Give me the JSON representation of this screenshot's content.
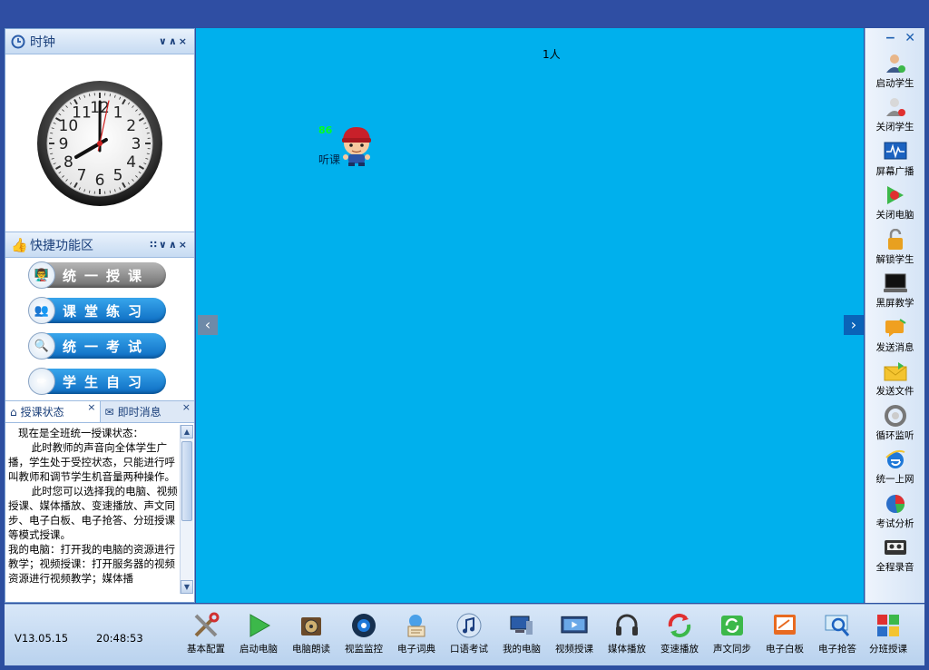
{
  "clock_panel": {
    "title": "时钟",
    "time": {
      "hour": 8,
      "minute": 0,
      "second": 2
    },
    "numerals": [
      "12",
      "1",
      "2",
      "3",
      "4",
      "5",
      "6",
      "7",
      "8",
      "9",
      "10",
      "11"
    ]
  },
  "quick_panel": {
    "title": "快捷功能区",
    "buttons": [
      {
        "label": "统一授课",
        "style": "gray",
        "icon": "teaching-icon"
      },
      {
        "label": "课堂练习",
        "style": "blue",
        "icon": "group-icon"
      },
      {
        "label": "统一考试",
        "style": "blue",
        "icon": "exam-icon"
      },
      {
        "label": "学生自习",
        "style": "blue",
        "icon": "pencil-icon"
      }
    ]
  },
  "tabs": [
    {
      "label": "授课状态",
      "icon": "home-icon",
      "close": "×"
    },
    {
      "label": "即时消息",
      "icon": "envelope-icon",
      "close": "×"
    }
  ],
  "status_text": [
    "   现在是全班统一授课状态：",
    "       此时教师的声音向全体学生广播，学生处于受控状态，只能进行呼叫教师和调节学生机音量两种操作。",
    "       此时您可以选择我的电脑、视频授课、媒体播放、变速播放、声文同步、电子白板、电子抢答、分班授课等模式授课。",
    "我的电脑：打开我的电脑的资源进行教学；视频授课：打开服务器的视频资源进行视频教学；媒体播"
  ],
  "main": {
    "count": "1人",
    "student": {
      "number": "86",
      "status": "听课"
    },
    "nav_left": "‹",
    "nav_right": "›"
  },
  "right_toolbar": [
    {
      "label": "启动学生",
      "icon": "start-student-icon"
    },
    {
      "label": "关闭学生",
      "icon": "close-student-icon"
    },
    {
      "label": "屏幕广播",
      "icon": "screen-broadcast-icon"
    },
    {
      "label": "关闭电脑",
      "icon": "shutdown-icon"
    },
    {
      "label": "解锁学生",
      "icon": "unlock-icon"
    },
    {
      "label": "黑屏教学",
      "icon": "black-screen-icon"
    },
    {
      "label": "发送消息",
      "icon": "message-icon"
    },
    {
      "label": "发送文件",
      "icon": "send-file-icon"
    },
    {
      "label": "循环监听",
      "icon": "loop-listen-icon"
    },
    {
      "label": "统一上网",
      "icon": "ie-icon"
    },
    {
      "label": "考试分析",
      "icon": "pie-chart-icon"
    },
    {
      "label": "全程录音",
      "icon": "tape-icon"
    }
  ],
  "bottom": {
    "version": "V13.05.15",
    "time": "20:48:53",
    "buttons": [
      {
        "label": "基本配置",
        "icon": "tools-icon"
      },
      {
        "label": "启动电脑",
        "icon": "play-icon"
      },
      {
        "label": "电脑朗读",
        "icon": "read-icon"
      },
      {
        "label": "视监监控",
        "icon": "monitor-icon"
      },
      {
        "label": "电子词典",
        "icon": "dictionary-icon"
      },
      {
        "label": "口语考试",
        "icon": "music-icon"
      },
      {
        "label": "我的电脑",
        "icon": "my-computer-icon"
      },
      {
        "label": "视频授课",
        "icon": "video-icon"
      },
      {
        "label": "媒体播放",
        "icon": "headphones-icon"
      },
      {
        "label": "变速播放",
        "icon": "speed-icon"
      },
      {
        "label": "声文同步",
        "icon": "sync-icon"
      },
      {
        "label": "电子白板",
        "icon": "whiteboard-icon"
      },
      {
        "label": "电子抢答",
        "icon": "quiz-icon"
      },
      {
        "label": "分班授课",
        "icon": "split-class-icon"
      }
    ]
  },
  "colors": {
    "main_bg": "#00b0ed",
    "title_bg": "#2f4ea3"
  }
}
